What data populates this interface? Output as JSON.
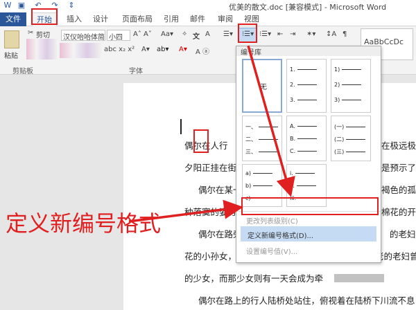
{
  "window": {
    "title": "优美的散文.doc [兼容模式] - Microsoft Word"
  },
  "tabs": [
    "文件",
    "开始",
    "插入",
    "设计",
    "页面布局",
    "引用",
    "邮件",
    "审阅",
    "视图"
  ],
  "clipboard": {
    "paste": "粘贴",
    "cut": "剪切",
    "group": "剪贴板"
  },
  "font": {
    "name": "汉仪咍咍体简",
    "size": "小四",
    "group": "字体"
  },
  "styles": {
    "sample": "AaBbCcDc"
  },
  "numbering_menu": {
    "library_title": "编号库",
    "none_label": "无",
    "formats": [
      [
        "1.",
        "2.",
        "3."
      ],
      [
        "1)",
        "2)",
        "3)"
      ],
      [
        "一、",
        "二、",
        "三、"
      ],
      [
        "A.",
        "B.",
        "C."
      ],
      [
        "(一)",
        "(二)",
        "(三)"
      ],
      [
        "a)",
        "b)",
        "c)"
      ],
      [
        "i.",
        "ii.",
        "iii."
      ]
    ],
    "change_level": "更改列表级别(C)",
    "define_new": "定义新编号格式(D)...",
    "set_value": "设置编号值(V)..."
  },
  "document": {
    "lines": [
      "偶尔在人行",
      "在极远极",
      "夕阳正挂在街的",
      "是预示了",
      "偶尔在某一",
      "褐色的孤",
      "种落寞的姿势",
      "棉花的开",
      "偶尔在路旁",
      "的老妇",
      "花的小孙女，匆匆地横过马路，这时我会想，那年老的老妇曾经",
      "的少女，而那少女则有一天会成为牵",
      "偶尔在路上的行人陆桥处站住，俯视着在陆桥下川流不息，往"
    ]
  },
  "annotation": {
    "text": "定义新编号格式"
  },
  "colors": {
    "accent": "#2b579a",
    "highlight": "#e02020"
  }
}
